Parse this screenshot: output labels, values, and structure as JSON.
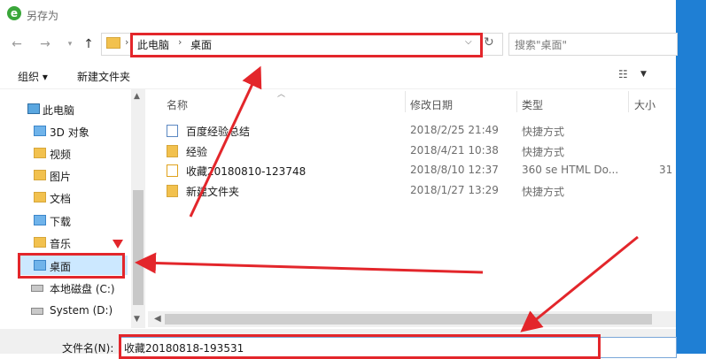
{
  "window": {
    "title": "另存为",
    "app_icon_glyph": "e"
  },
  "nav": {
    "address": {
      "segments": [
        "此电脑",
        "桌面"
      ],
      "separator": "›"
    },
    "search_placeholder": "搜索\"桌面\""
  },
  "toolbar": {
    "organize_label": "组织 ▾",
    "new_folder_label": "新建文件夹"
  },
  "navpane": {
    "items": [
      {
        "label": "此电脑",
        "icon": "computer-icon"
      },
      {
        "label": "3D 对象",
        "icon": "folder-3d-icon"
      },
      {
        "label": "视频",
        "icon": "folder-video-icon"
      },
      {
        "label": "图片",
        "icon": "folder-pictures-icon"
      },
      {
        "label": "文档",
        "icon": "folder-documents-icon"
      },
      {
        "label": "下载",
        "icon": "folder-downloads-icon"
      },
      {
        "label": "音乐",
        "icon": "folder-music-icon"
      },
      {
        "label": "桌面",
        "icon": "folder-desktop-icon",
        "selected": true
      },
      {
        "label": "本地磁盘 (C:)",
        "icon": "drive-icon"
      },
      {
        "label": "System (D:)",
        "icon": "drive-icon"
      }
    ]
  },
  "list": {
    "columns": [
      "名称",
      "修改日期",
      "类型",
      "大小"
    ],
    "rows": [
      {
        "name": "百度经验总结",
        "date": "2018/2/25 21:49",
        "type": "快捷方式",
        "size": "",
        "icon": "document-shortcut-icon"
      },
      {
        "name": "经验",
        "date": "2018/4/21 10:38",
        "type": "快捷方式",
        "size": "",
        "icon": "folder-shortcut-icon"
      },
      {
        "name": "收藏20180810-123748",
        "date": "2018/8/10 12:37",
        "type": "360 se HTML Do...",
        "size": "31",
        "icon": "html-file-icon"
      },
      {
        "name": "新建文件夹",
        "date": "2018/1/27 13:29",
        "type": "快捷方式",
        "size": "",
        "icon": "folder-shortcut-icon"
      }
    ]
  },
  "filename": {
    "label": "文件名(N):",
    "value": "收藏20180818-193531"
  },
  "colors": {
    "annotation_red": "#e3262b",
    "selection": "#cce8ff",
    "side_bar": "#1f7fd4"
  }
}
